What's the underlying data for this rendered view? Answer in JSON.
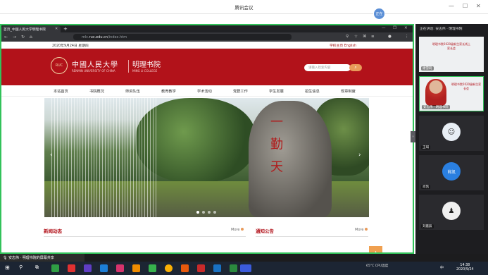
{
  "meeting": {
    "title": "腾讯会议",
    "avatar_label": "正在"
  },
  "browser": {
    "tab_title": "首页_中国人民大学明理书院",
    "url_prefix": "mlc.",
    "url_domain": "ruc.edu.cn",
    "url_path": "/index.htm"
  },
  "site": {
    "date": "2020年9月24日 星期四",
    "links": "学校主页    English",
    "university_cn": "中國人民大學",
    "university_en": "RENMIN UNIVERSITY OF CHINA",
    "college_cn": "明理书院",
    "college_en": "MING LI COLLEGE",
    "search_placeholder": "请输入检索内容",
    "menu": [
      "本站首页",
      "书院概况",
      "师资队伍",
      "教育教学",
      "学术活动",
      "党群工作",
      "学生发展",
      "招生信息",
      "规章制度"
    ],
    "hero_carving": "一 勤 天",
    "news_title": "新闻动态",
    "notice_title": "通知公告",
    "more_label": "More"
  },
  "sidebar": {
    "header": "正在讲话: 安志伟 · 明理书院",
    "tiles": [
      {
        "label": "谢雪莉",
        "avatar": "",
        "slide": "明理书院2020级新生家长线上家长会"
      },
      {
        "label": "安志伟 · 明理书院",
        "avatar": "",
        "slide": "明理书院2020级新生家长会"
      },
      {
        "label": "王琪",
        "avatar": ""
      },
      {
        "label": "肖凯",
        "avatar": "肖凯"
      },
      {
        "label": "刘嘉辰",
        "avatar": ""
      }
    ]
  },
  "share_bar": {
    "label": "安志伟 · 明理书院的屏幕共享"
  },
  "taskbar": {
    "weather": "65°C CPU温度",
    "time": "14:38",
    "date": "2020/9/24",
    "lang": "中"
  }
}
